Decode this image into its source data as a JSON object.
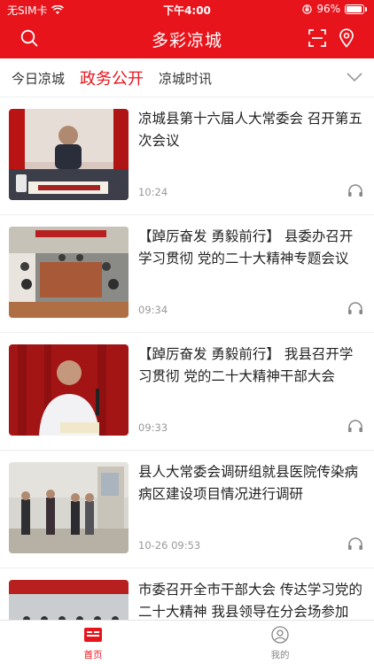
{
  "status_bar": {
    "carrier": "无SIM卡",
    "time": "下午4:00",
    "battery": "96%"
  },
  "header": {
    "title": "多彩凉城"
  },
  "tabs": [
    {
      "label": "今日凉城"
    },
    {
      "label": "政务公开"
    },
    {
      "label": "凉城时讯"
    }
  ],
  "feed": [
    {
      "title": "凉城县第十六届人大常委会 召开第五次会议",
      "time": "10:24"
    },
    {
      "title": "【踔厉奋发 勇毅前行】 县委办召开学习贯彻 党的二十大精神专题会议",
      "time": "09:34"
    },
    {
      "title": "【踔厉奋发 勇毅前行】 我县召开学习贯彻 党的二十大精神干部大会",
      "time": "09:33"
    },
    {
      "title": "县人大常委会调研组就县医院传染病 病区建设项目情况进行调研",
      "time": "10-26 09:53"
    },
    {
      "title": "市委召开全市干部大会 传达学习党的二十大精神 我县领导在分会场参加",
      "time": ""
    }
  ],
  "tabbar": [
    {
      "label": "首页"
    },
    {
      "label": "我的"
    }
  ],
  "colors": {
    "brand": "#e8141c"
  }
}
